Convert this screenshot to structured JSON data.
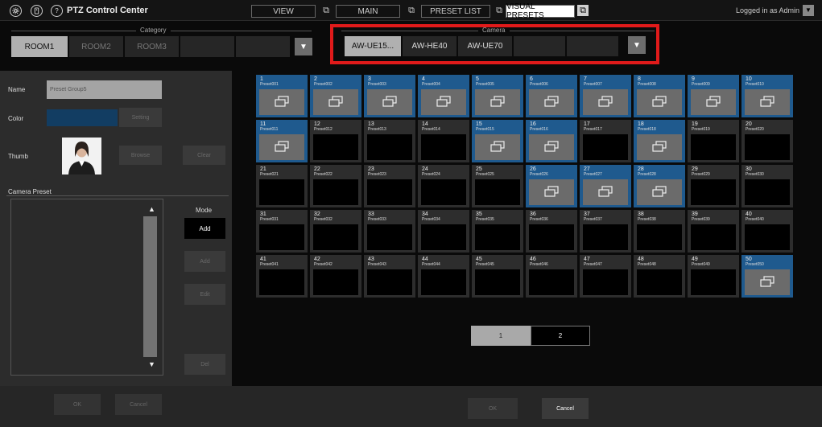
{
  "header": {
    "app_title": "PTZ Control Center",
    "icons": [
      "gear-icon",
      "remote-icon",
      "help-icon"
    ],
    "help_glyph": "?",
    "tabs": [
      {
        "label": "VIEW",
        "active": false
      },
      {
        "label": "MAIN",
        "active": false
      },
      {
        "label": "PRESET LIST",
        "active": false
      },
      {
        "label": "VISUAL PRESETS",
        "active": true
      }
    ],
    "login_text": "Logged in as Admin"
  },
  "category": {
    "title": "Category",
    "items": [
      "ROOM1",
      "ROOM2",
      "ROOM3",
      "",
      "",
      ""
    ],
    "selected": "ROOM1"
  },
  "camera": {
    "title": "Camera",
    "items": [
      "AW-UE15...",
      "AW-HE40",
      "AW-UE70",
      "",
      ""
    ],
    "selected": "AW-UE15..."
  },
  "left_panel": {
    "name_label": "Name",
    "name_value": "Preset Group5",
    "color_label": "Color",
    "color_value": "#123d62",
    "setting_label": "Setting",
    "thumb_label": "Thumb",
    "browse_label": "Browse",
    "clear_label": "Clear",
    "camera_preset_label": "Camera Preset",
    "mode_label": "Mode",
    "mode_add_label": "Add",
    "add_label": "Add",
    "edit_label": "Edit",
    "del_label": "Del"
  },
  "footer": {
    "left_ok": "OK",
    "left_cancel": "Cancel",
    "right_ok": "OK",
    "right_cancel": "Cancel"
  },
  "presets": [
    {
      "num": "1",
      "name": "Preset001",
      "on": true
    },
    {
      "num": "2",
      "name": "Preset002",
      "on": true
    },
    {
      "num": "3",
      "name": "Preset003",
      "on": true
    },
    {
      "num": "4",
      "name": "Preset004",
      "on": true
    },
    {
      "num": "5",
      "name": "Preset005",
      "on": true
    },
    {
      "num": "6",
      "name": "Preset006",
      "on": true
    },
    {
      "num": "7",
      "name": "Preset007",
      "on": true
    },
    {
      "num": "8",
      "name": "Preset008",
      "on": true
    },
    {
      "num": "9",
      "name": "Preset009",
      "on": true
    },
    {
      "num": "10",
      "name": "Preset010",
      "on": true
    },
    {
      "num": "11",
      "name": "Preset011",
      "on": true
    },
    {
      "num": "12",
      "name": "Preset012",
      "on": false
    },
    {
      "num": "13",
      "name": "Preset013",
      "on": false
    },
    {
      "num": "14",
      "name": "Preset014",
      "on": false
    },
    {
      "num": "15",
      "name": "Preset015",
      "on": true
    },
    {
      "num": "16",
      "name": "Preset016",
      "on": true
    },
    {
      "num": "17",
      "name": "Preset017",
      "on": false
    },
    {
      "num": "18",
      "name": "Preset018",
      "on": true
    },
    {
      "num": "19",
      "name": "Preset019",
      "on": false
    },
    {
      "num": "20",
      "name": "Preset020",
      "on": false
    },
    {
      "num": "21",
      "name": "Preset021",
      "on": false
    },
    {
      "num": "22",
      "name": "Preset022",
      "on": false
    },
    {
      "num": "23",
      "name": "Preset023",
      "on": false
    },
    {
      "num": "24",
      "name": "Preset024",
      "on": false
    },
    {
      "num": "25",
      "name": "Preset025",
      "on": false
    },
    {
      "num": "26",
      "name": "Preset026",
      "on": true
    },
    {
      "num": "27",
      "name": "Preset027",
      "on": true
    },
    {
      "num": "28",
      "name": "Preset028",
      "on": true
    },
    {
      "num": "29",
      "name": "Preset029",
      "on": false
    },
    {
      "num": "30",
      "name": "Preset030",
      "on": false
    },
    {
      "num": "31",
      "name": "Preset031",
      "on": false
    },
    {
      "num": "32",
      "name": "Preset032",
      "on": false
    },
    {
      "num": "33",
      "name": "Preset033",
      "on": false
    },
    {
      "num": "34",
      "name": "Preset034",
      "on": false
    },
    {
      "num": "35",
      "name": "Preset035",
      "on": false
    },
    {
      "num": "36",
      "name": "Preset036",
      "on": false
    },
    {
      "num": "37",
      "name": "Preset037",
      "on": false
    },
    {
      "num": "38",
      "name": "Preset038",
      "on": false
    },
    {
      "num": "39",
      "name": "Preset039",
      "on": false
    },
    {
      "num": "40",
      "name": "Preset040",
      "on": false
    },
    {
      "num": "41",
      "name": "Preset041",
      "on": false
    },
    {
      "num": "42",
      "name": "Preset042",
      "on": false
    },
    {
      "num": "43",
      "name": "Preset043",
      "on": false
    },
    {
      "num": "44",
      "name": "Preset044",
      "on": false
    },
    {
      "num": "45",
      "name": "Preset045",
      "on": false
    },
    {
      "num": "46",
      "name": "Preset046",
      "on": false
    },
    {
      "num": "47",
      "name": "Preset047",
      "on": false
    },
    {
      "num": "48",
      "name": "Preset048",
      "on": false
    },
    {
      "num": "49",
      "name": "Preset049",
      "on": false
    },
    {
      "num": "50",
      "name": "Preset050",
      "on": true
    }
  ],
  "pagination": {
    "pages": [
      "1",
      "2"
    ],
    "current": "1"
  },
  "colors": {
    "accent_blue": "#1f5a8e",
    "highlight_red": "#e01a1a"
  }
}
